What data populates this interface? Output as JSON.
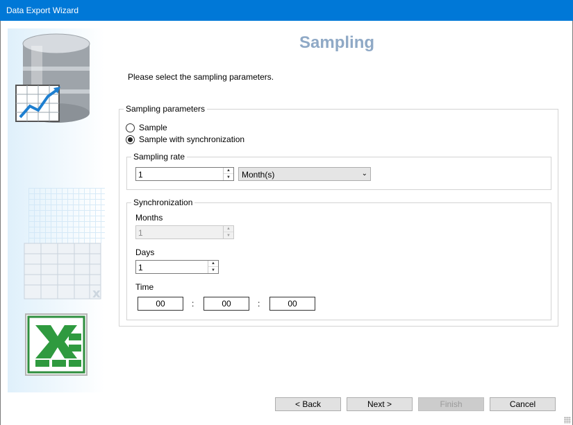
{
  "window": {
    "title": "Data Export Wizard"
  },
  "page": {
    "title": "Sampling",
    "instruction": "Please select the sampling parameters."
  },
  "sampling_parameters": {
    "legend": "Sampling parameters",
    "options": [
      {
        "label": "Sample",
        "checked": false
      },
      {
        "label": "Sample with synchronization",
        "checked": true
      }
    ]
  },
  "sampling_rate": {
    "legend": "Sampling rate",
    "value": "1",
    "unit": "Month(s)"
  },
  "synchronization": {
    "legend": "Synchronization",
    "months_label": "Months",
    "months_value": "1",
    "days_label": "Days",
    "days_value": "1",
    "time_label": "Time",
    "time_hours": "00",
    "time_minutes": "00",
    "time_seconds": "00",
    "separator": ":"
  },
  "buttons": {
    "back": "< Back",
    "next": "Next >",
    "finish": "Finish",
    "cancel": "Cancel"
  },
  "sidebar": {
    "icons": [
      "database-icon",
      "chart-icon",
      "spreadsheet-icon",
      "excel-icon"
    ]
  }
}
